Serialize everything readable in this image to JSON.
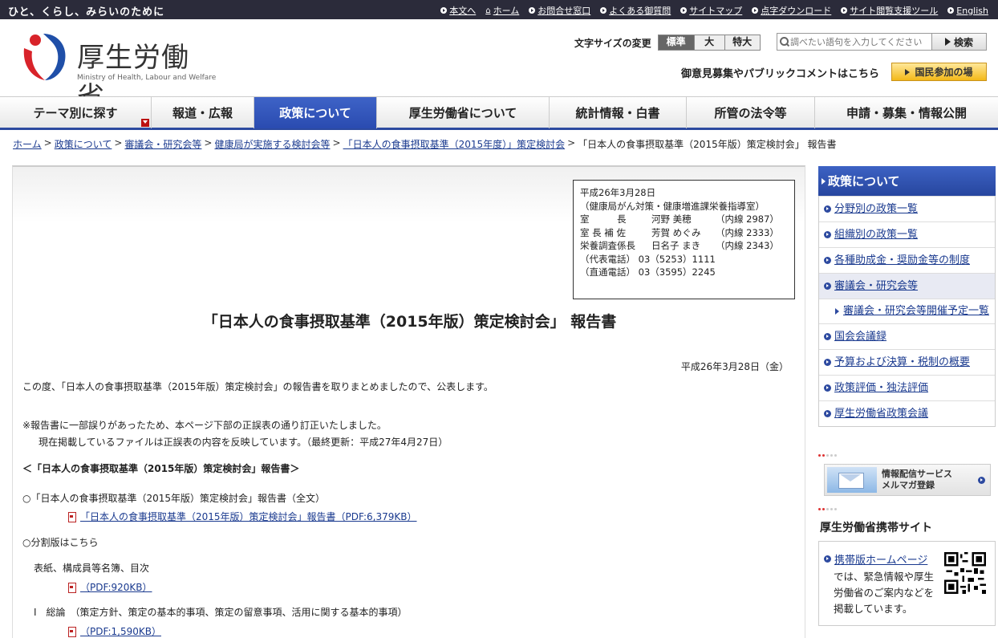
{
  "topbar": {
    "tagline": "ひと、くらし、みらいのために",
    "links": [
      "本文へ",
      "ホーム",
      "お問合せ窓口",
      "よくある御質問",
      "サイトマップ",
      "点字ダウンロード",
      "サイト閲覧支援ツール",
      "English"
    ]
  },
  "header": {
    "logo_name": "厚生労働省",
    "logo_en": "Ministry of Health, Labour and Welfare",
    "fontsize_label": "文字サイズの変更",
    "fontsize_options": [
      "標準",
      "大",
      "特大"
    ],
    "search_placeholder": "調べたい語句を入力してください",
    "search_button": "検索",
    "public_comment": "御意見募集やパブリックコメントはこちら",
    "participation_button": "国民参加の場"
  },
  "nav": [
    "テーマ別に探す",
    "報道・広報",
    "政策について",
    "厚生労働省について",
    "統計情報・白書",
    "所管の法令等",
    "申請・募集・情報公開"
  ],
  "breadcrumb": {
    "links": [
      "ホーム",
      "政策について",
      "審議会・研究会等",
      "健康局が実施する検討会等",
      "「日本人の食事摂取基準（2015年度）」策定検討会"
    ],
    "current": "「日本人の食事摂取基準（2015年版）策定検討会」 報告書"
  },
  "contact": {
    "date": "平成26年3月28日",
    "dept": "（健康局がん対策・健康増進課栄養指導室）",
    "people": [
      {
        "role": "室　　　長",
        "name": "河野 美穂",
        "ext": "（内線 2987）"
      },
      {
        "role": "室 長 補 佐",
        "name": "芳賀 めぐみ",
        "ext": "（内線 2333）"
      },
      {
        "role": "栄養調査係長",
        "name": "日名子 まき",
        "ext": "（内線 2343）"
      }
    ],
    "phone_main": "（代表電話） 03（5253）1111",
    "phone_direct": "（直通電話） 03（3595）2245"
  },
  "content": {
    "title": "「日本人の食事摂取基準（2015年版）策定検討会」 報告書",
    "pub_date": "平成26年3月28日（金）",
    "intro": "この度、「日本人の食事摂取基準（2015年版）策定検討会」の報告書を取りまとめましたので、公表します。",
    "note1": "※報告書に一部誤りがあったため、本ページ下部の正誤表の通り訂正いたしました。",
    "note2": "現在掲載しているファイルは正誤表の内容を反映しています。（最終更新：平成27年4月27日）",
    "section_head": "＜「日本人の食事摂取基準（2015年版）策定検討会」報告書＞",
    "full_head": "○「日本人の食事摂取基準（2015年版）策定検討会」報告書（全文）",
    "full_pdf": "「日本人の食事摂取基準（2015年版）策定検討会」報告書（PDF:6,379KB）",
    "split_head": "○分割版はこちら",
    "cover_head": "表紙、構成員等名簿、目次",
    "cover_pdf": "（PDF:920KB）",
    "overview_head": "I　総論　（策定方針、策定の基本的事項、策定の留意事項、活用に関する基本的事項）",
    "overview_pdf": "（PDF:1,590KB）"
  },
  "sidebar": {
    "heading": "政策について",
    "items": [
      {
        "label": "分野別の政策一覧"
      },
      {
        "label": "組織別の政策一覧"
      },
      {
        "label": "各種助成金・奨励金等の制度"
      },
      {
        "label": "審議会・研究会等"
      },
      {
        "label": "審議会・研究会等開催予定一覧"
      },
      {
        "label": "国会会議録"
      },
      {
        "label": "予算および決算・税制の概要"
      },
      {
        "label": "政策評価・独法評価"
      },
      {
        "label": "厚生労働省政策会議"
      }
    ],
    "mail_banner_line1": "情報配信サービス",
    "mail_banner_line2": "メルマガ登録",
    "mobile_heading": "厚生労働省携帯サイト",
    "mobile_link": "携帯版ホームページ",
    "mobile_desc": "では、緊急情報や厚生労働省のご案内などを掲載しています。"
  },
  "colors": {
    "accent_blue": "#2d4aa0",
    "topbar": "#2b2b3a",
    "button_gold": "#f3b918",
    "pdf_red": "#b22222"
  },
  "icons": [
    "logo-mark-icon",
    "search-icon",
    "arrow-icon",
    "home-icon",
    "pdf-icon",
    "envelope-icon",
    "qr-code-icon"
  ]
}
